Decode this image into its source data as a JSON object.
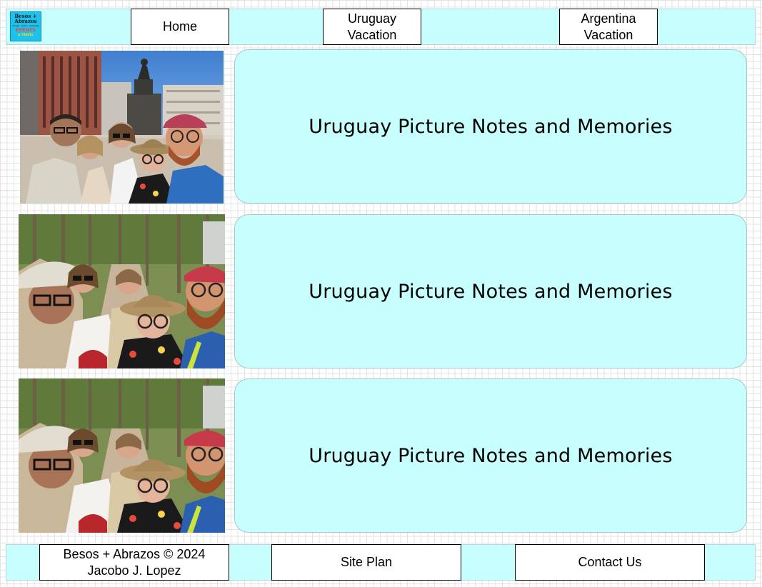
{
  "header": {
    "logo": {
      "line1": "Besos +",
      "line2": "Abrazos",
      "tagline": "design · build · celebrate",
      "badge": "EVENTS",
      "sub": "& TRAVEL"
    },
    "nav": [
      {
        "label_line1": "Home",
        "label_line2": ""
      },
      {
        "label_line1": "Uruguay",
        "label_line2": "Vacation"
      },
      {
        "label_line1": "Argentina",
        "label_line2": "Vacation"
      }
    ]
  },
  "main": {
    "rows": [
      {
        "photo": "group-selfie-plaza-independencia",
        "card_title": "Uruguay Picture Notes and Memories"
      },
      {
        "photo": "group-selfie-tree-lined-park",
        "card_title": "Uruguay Picture Notes and Memories"
      },
      {
        "photo": "group-selfie-tree-lined-park",
        "card_title": "Uruguay Picture Notes and Memories"
      }
    ]
  },
  "footer": {
    "copyright_line1": "Besos + Abrazos © 2024",
    "copyright_line2": "Jacobo J. Lopez",
    "site_plan": "Site Plan",
    "contact": "Contact Us"
  },
  "colors": {
    "bar_background": "#c7ffff",
    "card_background": "#c7ffff",
    "logo_background": "#1ec0ec",
    "grid_lines": "#e3e3e3"
  }
}
